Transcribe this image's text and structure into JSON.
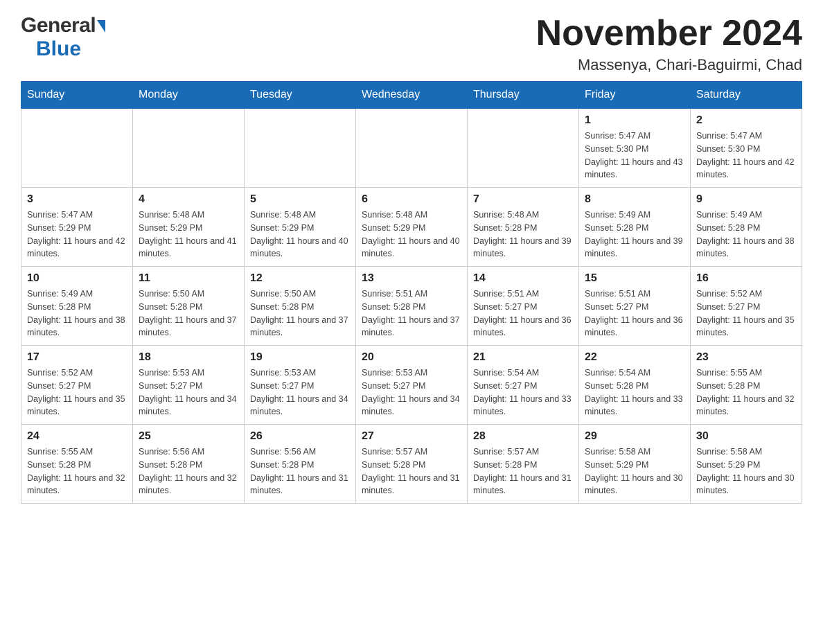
{
  "logo": {
    "general_text": "General",
    "blue_text": "Blue"
  },
  "header": {
    "month_year": "November 2024",
    "location": "Massenya, Chari-Baguirmi, Chad"
  },
  "weekdays": [
    "Sunday",
    "Monday",
    "Tuesday",
    "Wednesday",
    "Thursday",
    "Friday",
    "Saturday"
  ],
  "weeks": [
    [
      {
        "day": "",
        "info": ""
      },
      {
        "day": "",
        "info": ""
      },
      {
        "day": "",
        "info": ""
      },
      {
        "day": "",
        "info": ""
      },
      {
        "day": "",
        "info": ""
      },
      {
        "day": "1",
        "info": "Sunrise: 5:47 AM\nSunset: 5:30 PM\nDaylight: 11 hours and 43 minutes."
      },
      {
        "day": "2",
        "info": "Sunrise: 5:47 AM\nSunset: 5:30 PM\nDaylight: 11 hours and 42 minutes."
      }
    ],
    [
      {
        "day": "3",
        "info": "Sunrise: 5:47 AM\nSunset: 5:29 PM\nDaylight: 11 hours and 42 minutes."
      },
      {
        "day": "4",
        "info": "Sunrise: 5:48 AM\nSunset: 5:29 PM\nDaylight: 11 hours and 41 minutes."
      },
      {
        "day": "5",
        "info": "Sunrise: 5:48 AM\nSunset: 5:29 PM\nDaylight: 11 hours and 40 minutes."
      },
      {
        "day": "6",
        "info": "Sunrise: 5:48 AM\nSunset: 5:29 PM\nDaylight: 11 hours and 40 minutes."
      },
      {
        "day": "7",
        "info": "Sunrise: 5:48 AM\nSunset: 5:28 PM\nDaylight: 11 hours and 39 minutes."
      },
      {
        "day": "8",
        "info": "Sunrise: 5:49 AM\nSunset: 5:28 PM\nDaylight: 11 hours and 39 minutes."
      },
      {
        "day": "9",
        "info": "Sunrise: 5:49 AM\nSunset: 5:28 PM\nDaylight: 11 hours and 38 minutes."
      }
    ],
    [
      {
        "day": "10",
        "info": "Sunrise: 5:49 AM\nSunset: 5:28 PM\nDaylight: 11 hours and 38 minutes."
      },
      {
        "day": "11",
        "info": "Sunrise: 5:50 AM\nSunset: 5:28 PM\nDaylight: 11 hours and 37 minutes."
      },
      {
        "day": "12",
        "info": "Sunrise: 5:50 AM\nSunset: 5:28 PM\nDaylight: 11 hours and 37 minutes."
      },
      {
        "day": "13",
        "info": "Sunrise: 5:51 AM\nSunset: 5:28 PM\nDaylight: 11 hours and 37 minutes."
      },
      {
        "day": "14",
        "info": "Sunrise: 5:51 AM\nSunset: 5:27 PM\nDaylight: 11 hours and 36 minutes."
      },
      {
        "day": "15",
        "info": "Sunrise: 5:51 AM\nSunset: 5:27 PM\nDaylight: 11 hours and 36 minutes."
      },
      {
        "day": "16",
        "info": "Sunrise: 5:52 AM\nSunset: 5:27 PM\nDaylight: 11 hours and 35 minutes."
      }
    ],
    [
      {
        "day": "17",
        "info": "Sunrise: 5:52 AM\nSunset: 5:27 PM\nDaylight: 11 hours and 35 minutes."
      },
      {
        "day": "18",
        "info": "Sunrise: 5:53 AM\nSunset: 5:27 PM\nDaylight: 11 hours and 34 minutes."
      },
      {
        "day": "19",
        "info": "Sunrise: 5:53 AM\nSunset: 5:27 PM\nDaylight: 11 hours and 34 minutes."
      },
      {
        "day": "20",
        "info": "Sunrise: 5:53 AM\nSunset: 5:27 PM\nDaylight: 11 hours and 34 minutes."
      },
      {
        "day": "21",
        "info": "Sunrise: 5:54 AM\nSunset: 5:27 PM\nDaylight: 11 hours and 33 minutes."
      },
      {
        "day": "22",
        "info": "Sunrise: 5:54 AM\nSunset: 5:28 PM\nDaylight: 11 hours and 33 minutes."
      },
      {
        "day": "23",
        "info": "Sunrise: 5:55 AM\nSunset: 5:28 PM\nDaylight: 11 hours and 32 minutes."
      }
    ],
    [
      {
        "day": "24",
        "info": "Sunrise: 5:55 AM\nSunset: 5:28 PM\nDaylight: 11 hours and 32 minutes."
      },
      {
        "day": "25",
        "info": "Sunrise: 5:56 AM\nSunset: 5:28 PM\nDaylight: 11 hours and 32 minutes."
      },
      {
        "day": "26",
        "info": "Sunrise: 5:56 AM\nSunset: 5:28 PM\nDaylight: 11 hours and 31 minutes."
      },
      {
        "day": "27",
        "info": "Sunrise: 5:57 AM\nSunset: 5:28 PM\nDaylight: 11 hours and 31 minutes."
      },
      {
        "day": "28",
        "info": "Sunrise: 5:57 AM\nSunset: 5:28 PM\nDaylight: 11 hours and 31 minutes."
      },
      {
        "day": "29",
        "info": "Sunrise: 5:58 AM\nSunset: 5:29 PM\nDaylight: 11 hours and 30 minutes."
      },
      {
        "day": "30",
        "info": "Sunrise: 5:58 AM\nSunset: 5:29 PM\nDaylight: 11 hours and 30 minutes."
      }
    ]
  ]
}
